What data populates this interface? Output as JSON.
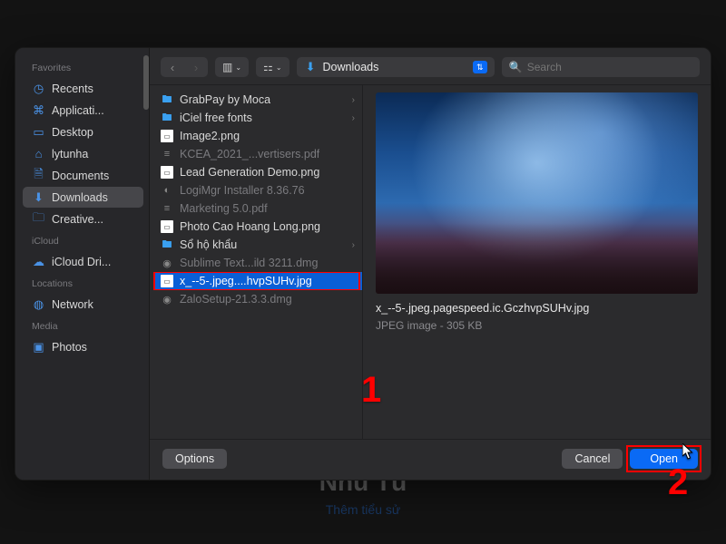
{
  "backdrop": {
    "name": "Nhũ Tú",
    "subtitle": "Thêm tiểu sử"
  },
  "toolbar": {
    "location_label": "Downloads",
    "search_placeholder": "Search"
  },
  "sidebar": {
    "sections": [
      {
        "title": "Favorites",
        "items": [
          {
            "label": "Recents",
            "icon": "clock-icon",
            "selected": false
          },
          {
            "label": "Applicati...",
            "icon": "app-icon",
            "selected": false
          },
          {
            "label": "Desktop",
            "icon": "desktop-icon",
            "selected": false
          },
          {
            "label": "lytunha",
            "icon": "home-icon",
            "selected": false
          },
          {
            "label": "Documents",
            "icon": "doc-icon",
            "selected": false
          },
          {
            "label": "Downloads",
            "icon": "download-icon",
            "selected": true
          },
          {
            "label": "Creative...",
            "icon": "folder-icon",
            "selected": false
          }
        ]
      },
      {
        "title": "iCloud",
        "items": [
          {
            "label": "iCloud Dri...",
            "icon": "cloud-icon",
            "selected": false
          }
        ]
      },
      {
        "title": "Locations",
        "items": [
          {
            "label": "Network",
            "icon": "globe-icon",
            "selected": false
          }
        ]
      },
      {
        "title": "Media",
        "items": [
          {
            "label": "Photos",
            "icon": "photos-icon",
            "selected": false
          }
        ]
      }
    ]
  },
  "files": [
    {
      "name": "GrabPay by Moca",
      "type": "folder",
      "dim": false
    },
    {
      "name": "iCiel free fonts",
      "type": "folder",
      "dim": false
    },
    {
      "name": "Image2.png",
      "type": "png",
      "dim": false
    },
    {
      "name": "KCEA_2021_...vertisers.pdf",
      "type": "pdf",
      "dim": true
    },
    {
      "name": "Lead Generation Demo.png",
      "type": "png",
      "dim": false
    },
    {
      "name": "LogiMgr Installer 8.36.76",
      "type": "app",
      "dim": true
    },
    {
      "name": "Marketing 5.0.pdf",
      "type": "pdf",
      "dim": true
    },
    {
      "name": "Photo Cao Hoang Long.png",
      "type": "png",
      "dim": false
    },
    {
      "name": "Sổ hộ khẩu",
      "type": "folder",
      "dim": false
    },
    {
      "name": "Sublime Text...ild 3211.dmg",
      "type": "dmg",
      "dim": true
    },
    {
      "name": "x_--5-.jpeg....hvpSUHv.jpg",
      "type": "jpg",
      "dim": false,
      "selected": true
    },
    {
      "name": "ZaloSetup-21.3.3.dmg",
      "type": "dmg",
      "dim": true
    }
  ],
  "preview": {
    "filename": "x_--5-.jpeg.pagespeed.ic.GczhvpSUHv.jpg",
    "kind": "JPEG image",
    "size": "305 KB"
  },
  "footer": {
    "options": "Options",
    "cancel": "Cancel",
    "open": "Open"
  },
  "callouts": {
    "one": "1",
    "two": "2"
  }
}
